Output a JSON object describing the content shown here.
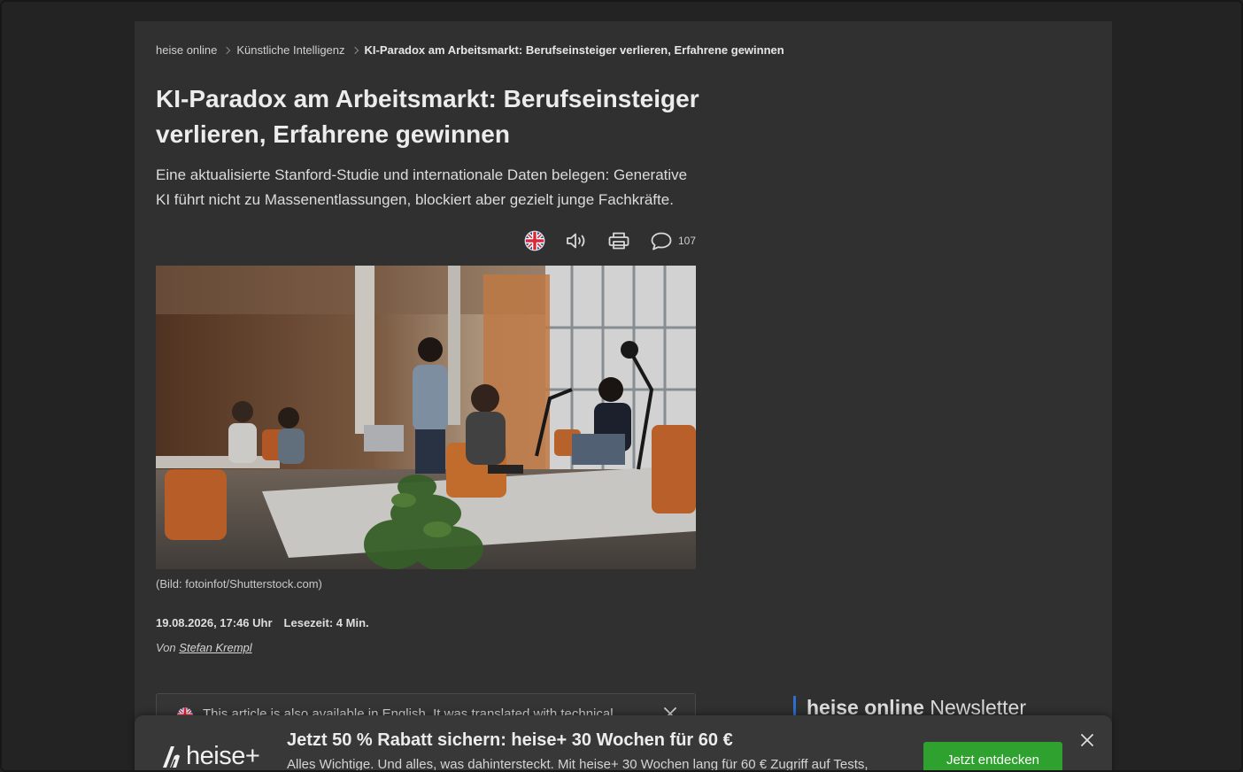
{
  "breadcrumb": {
    "items": [
      "heise online",
      "Künstliche Intelligenz"
    ],
    "current": "KI-Paradox am Arbeitsmarkt: Berufseinsteiger verlieren, Erfahrene gewinnen"
  },
  "article": {
    "title": "KI-Paradox am Arbeitsmarkt: Berufseinsteiger verlieren, Erfahrene gewinnen",
    "lead": "Eine aktualisierte Stanford-Studie und internationale Daten belegen: Generative KI führt nicht zu Massenentlassungen, blockiert aber gezielt junge Fachkräfte.",
    "comment_count": "107",
    "image_caption": "(Bild: fotoinfot/Shutterstock.com)",
    "date": "19.08.2026, 17:46 Uhr",
    "reading_time": "Lesezeit: 4 Min.",
    "byline_prefix": "Von",
    "author": "Stefan Krempl"
  },
  "actions": {
    "icons": [
      "uk-flag-icon",
      "speaker-icon",
      "printer-icon",
      "comment-icon"
    ]
  },
  "notice": {
    "text": "This article is also available in English. It was translated with technical"
  },
  "sidebar": {
    "newsletter_brand": "heise online",
    "newsletter_word": "Newsletter"
  },
  "promo": {
    "logo": "heise+",
    "title": "Jetzt 50 % Rabatt sichern: heise+ 30 Wochen für 60 €",
    "text": "Alles Wichtige. Und alles, was dahintersteckt. Mit heise+ 30 Wochen lang für 60 € Zugriff auf Tests,",
    "cta": "Jetzt entdecken"
  },
  "colors": {
    "page_bg": "#303030",
    "outer_bg": "#232323",
    "cta_green": "#2ea12e",
    "newsletter_accent": "#2c6fd1"
  }
}
